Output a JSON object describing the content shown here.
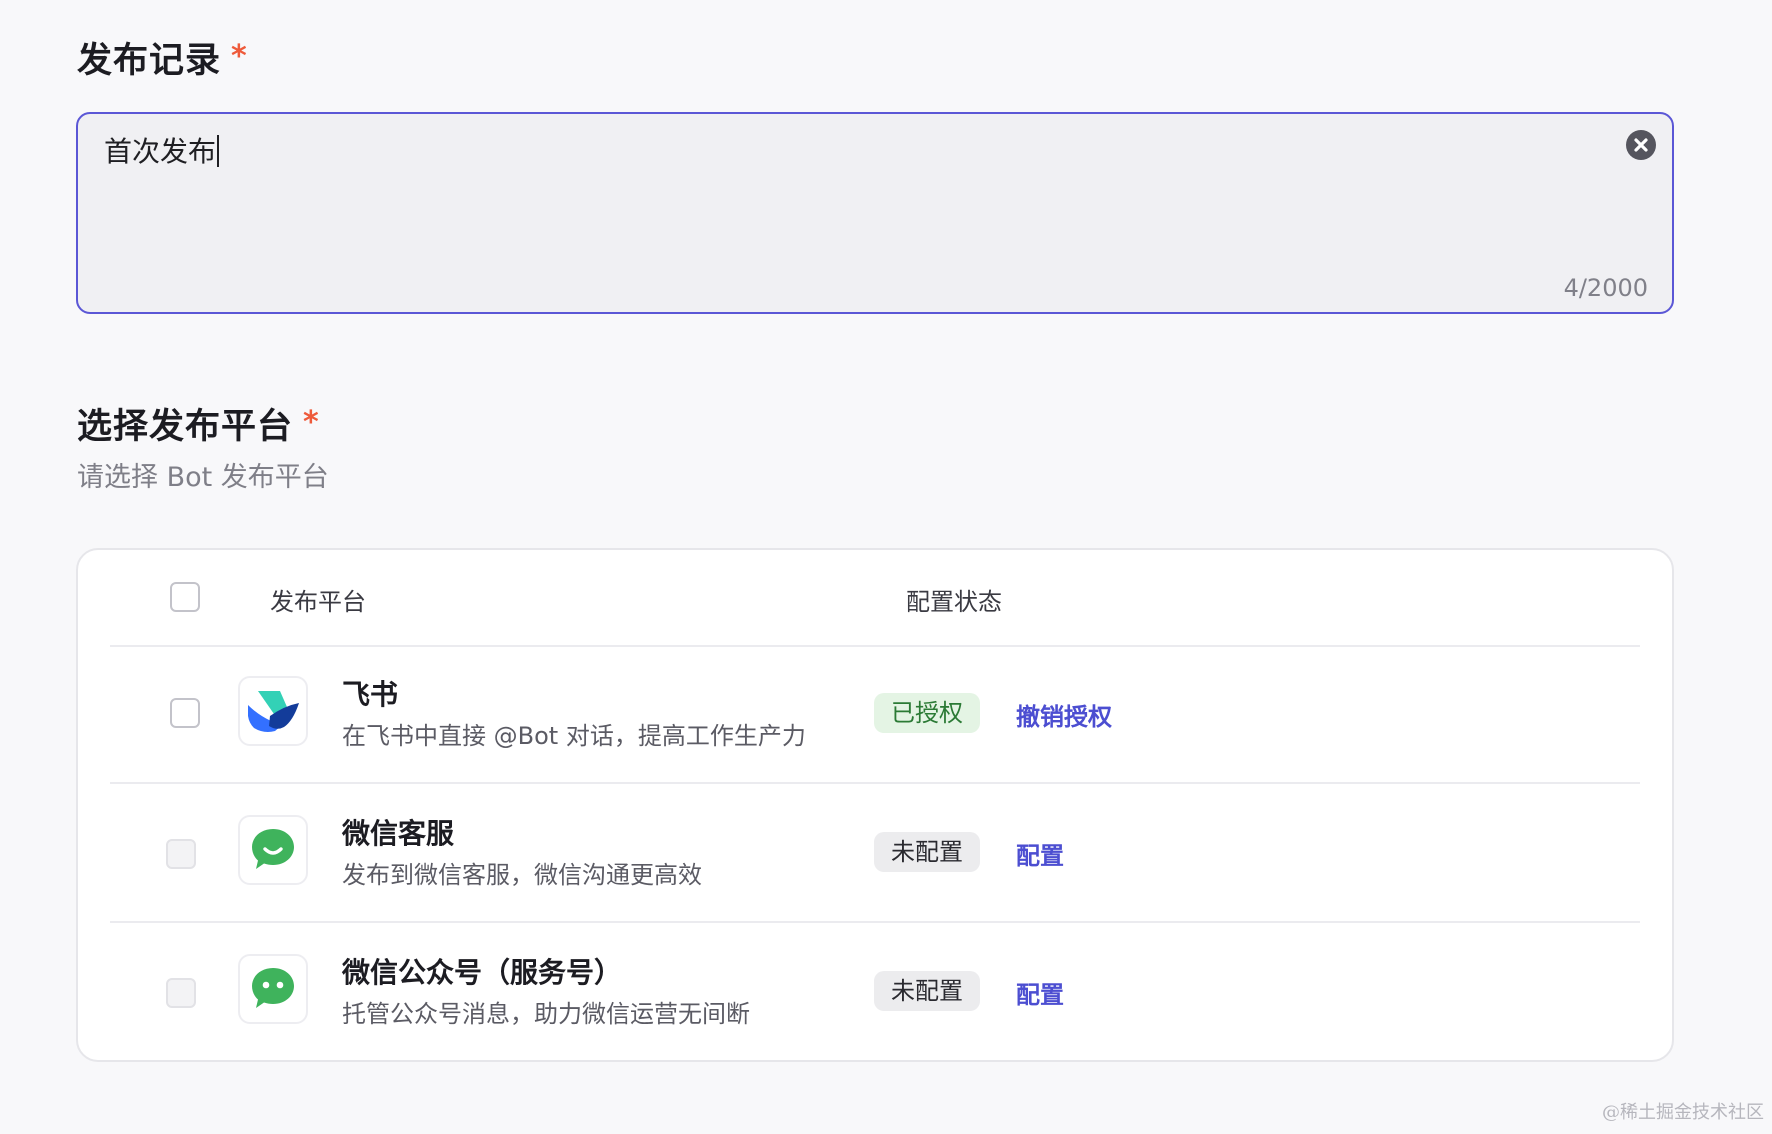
{
  "record": {
    "title": "发布记录",
    "required_mark": "*",
    "value": "首次发布",
    "counter": "4/2000"
  },
  "platform": {
    "title": "选择发布平台",
    "required_mark": "*",
    "subtitle": "请选择 Bot 发布平台"
  },
  "table": {
    "headers": {
      "platform": "发布平台",
      "status": "配置状态"
    },
    "rows": [
      {
        "name": "飞书",
        "description": "在飞书中直接 @Bot 对话，提高工作生产力",
        "status": "已授权",
        "action": "撤销授权",
        "icon": "feishu-logo-icon"
      },
      {
        "name": "微信客服",
        "description": "发布到微信客服，微信沟通更高效",
        "status": "未配置",
        "action": "配置",
        "icon": "wechat-service-logo-icon"
      },
      {
        "name": "微信公众号（服务号）",
        "description": "托管公众号消息，助力微信运营无间断",
        "status": "未配置",
        "action": "配置",
        "icon": "wechat-official-logo-icon"
      }
    ]
  },
  "watermark": "@稀土掘金技术社区",
  "colors": {
    "accent": "#5b57d6",
    "link": "#4c4ed1",
    "required": "#ee5a3a",
    "authorized_bg": "#e4f4e4",
    "authorized_text": "#2b7a35",
    "wechat_green": "#3fb35c"
  }
}
